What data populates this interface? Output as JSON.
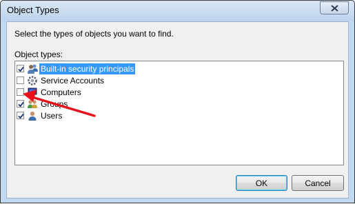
{
  "window": {
    "title": "Object Types"
  },
  "dialog": {
    "instruction": "Select the types of objects you want to find.",
    "list_label": "Object types:"
  },
  "object_types": [
    {
      "label": "Built-in security principals",
      "checked": true,
      "selected": true,
      "icon": "security-principals-icon"
    },
    {
      "label": "Service Accounts",
      "checked": false,
      "selected": false,
      "icon": "service-account-icon"
    },
    {
      "label": "Computers",
      "checked": false,
      "selected": false,
      "icon": "computer-icon"
    },
    {
      "label": "Groups",
      "checked": true,
      "selected": false,
      "icon": "group-icon"
    },
    {
      "label": "Users",
      "checked": true,
      "selected": false,
      "icon": "user-icon"
    }
  ],
  "buttons": {
    "ok": "OK",
    "cancel": "Cancel"
  },
  "annotation": {
    "color": "#e8101a",
    "icon": "red-arrow-annotation"
  }
}
